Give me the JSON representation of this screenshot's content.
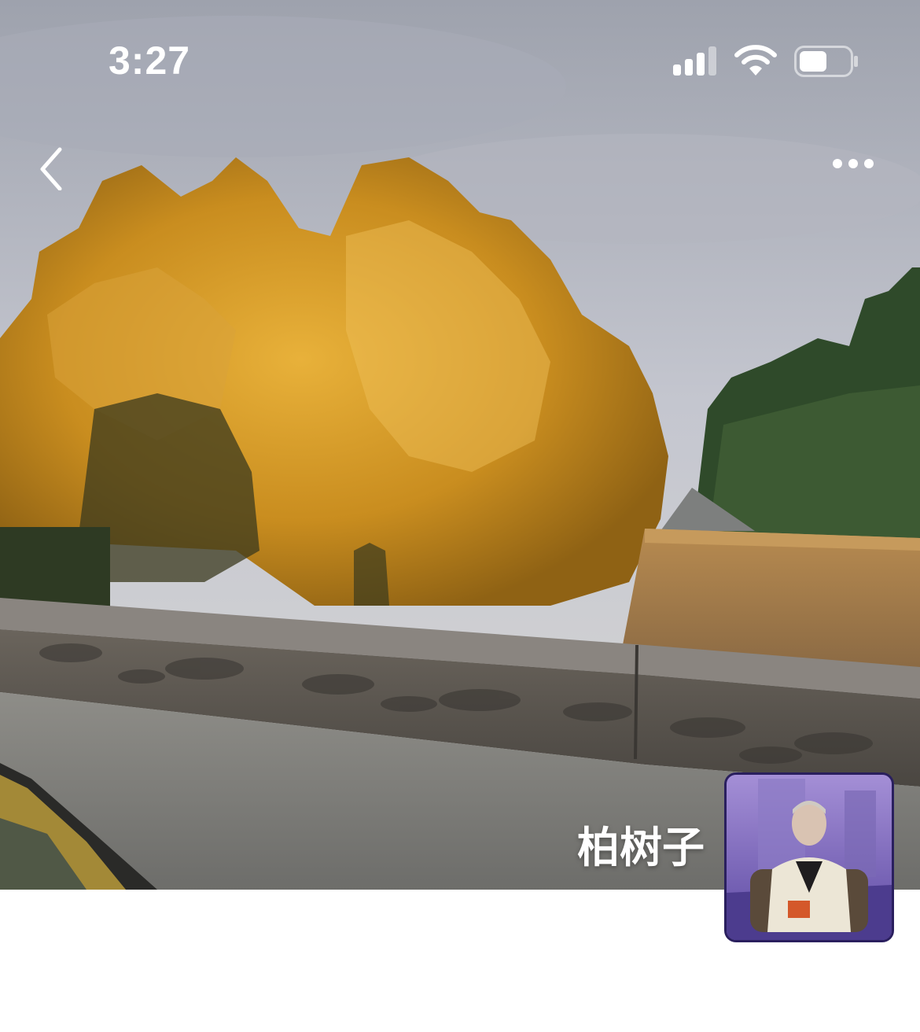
{
  "status_bar": {
    "time": "3:27",
    "signal_icon": "cellular-signal-icon",
    "wifi_icon": "wifi-icon",
    "battery_icon": "battery-icon",
    "battery_level": 0.55
  },
  "nav": {
    "back_icon": "chevron-left-icon",
    "more_icon": "more-horizontal-icon"
  },
  "profile": {
    "name": "柏树子",
    "avatar_icon": "avatar"
  },
  "colors": {
    "status_text": "#ffffff",
    "name_text": "#ffffff",
    "page_background": "#ffffff",
    "avatar_border": "#2a1f5e"
  }
}
